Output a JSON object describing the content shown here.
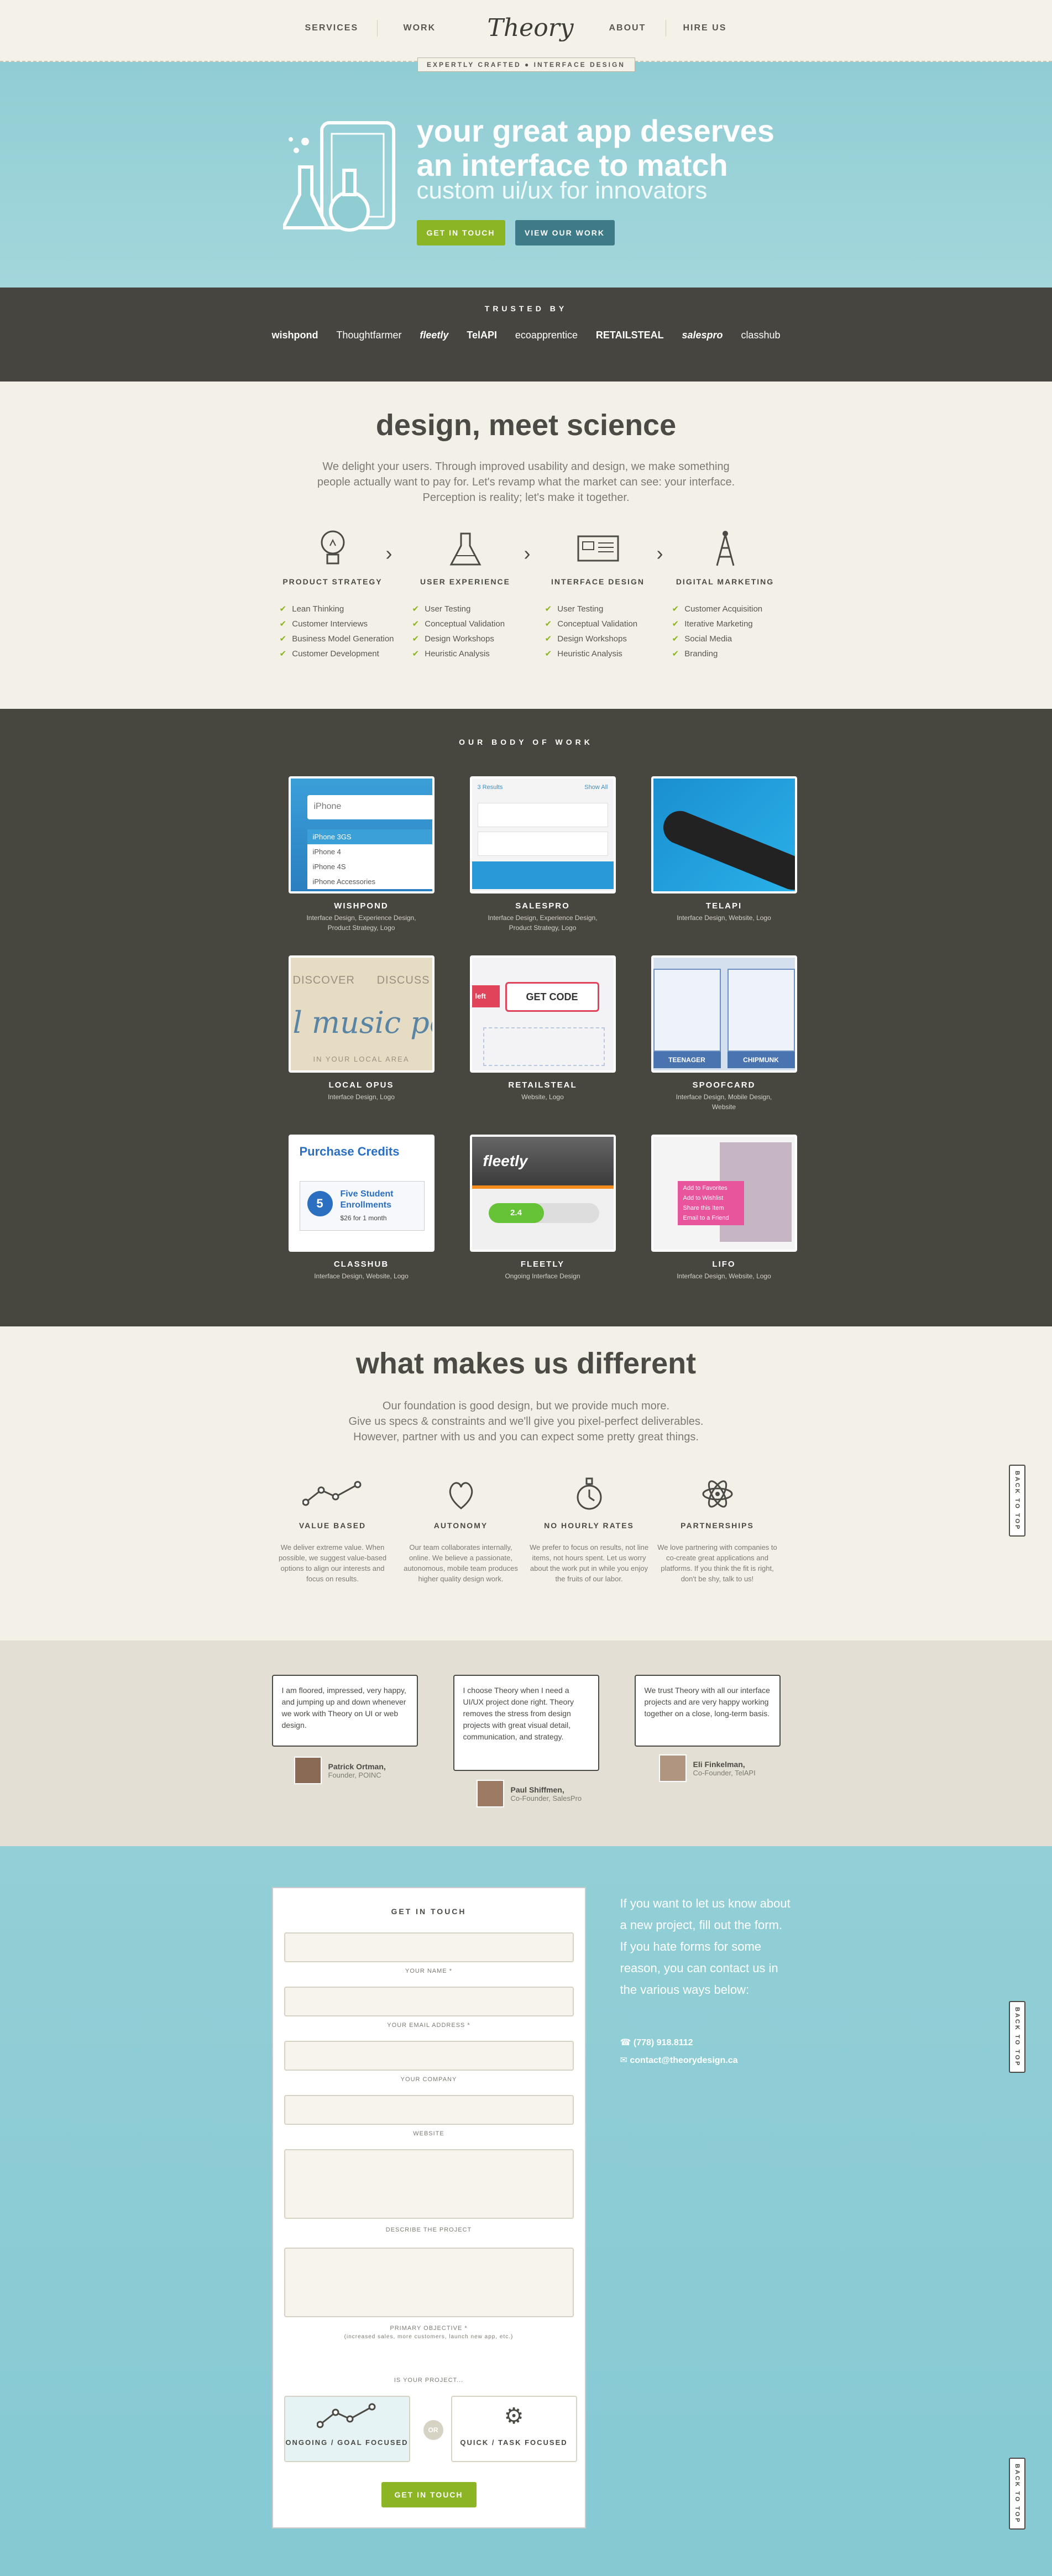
{
  "nav": {
    "services": "SERVICES",
    "work": "WORK",
    "logo": "Theory",
    "about": "ABOUT",
    "hire": "HIRE US",
    "tagline": "EXPERTLY CRAFTED ● INTERFACE DESIGN"
  },
  "hero": {
    "headline_1": "your great app deserves",
    "headline_2": "an interface to match",
    "subline": "custom ui/ux for innovators",
    "cta_primary": "GET IN TOUCH",
    "cta_secondary": "VIEW OUR WORK"
  },
  "trusted": {
    "title": "TRUSTED BY",
    "logos": [
      "wishpond",
      "Thoughtfarmer",
      "fleetly",
      "TelAPI",
      "ecoapprentice",
      "RETAILSTEAL",
      "salespro",
      "classhub"
    ]
  },
  "science": {
    "title": "design, meet science",
    "body_1": "We delight your users. Through improved usability and design, we make something",
    "body_2": "people actually want to pay for. Let's revamp what the market can see: your interface.",
    "body_3": "Perception is reality; let's make it together.",
    "services": [
      {
        "title": "PRODUCT STRATEGY",
        "items": [
          "Lean Thinking",
          "Customer Interviews",
          "Business Model Generation",
          "Customer Development"
        ]
      },
      {
        "title": "USER EXPERIENCE",
        "items": [
          "User Testing",
          "Conceptual Validation",
          "Design Workshops",
          "Heuristic Analysis"
        ]
      },
      {
        "title": "INTERFACE DESIGN",
        "items": [
          "User Testing",
          "Conceptual Validation",
          "Design Workshops",
          "Heuristic Analysis"
        ]
      },
      {
        "title": "DIGITAL MARKETING",
        "items": [
          "Customer Acquisition",
          "Iterative Marketing",
          "Social Media",
          "Branding"
        ]
      }
    ]
  },
  "work": {
    "title": "OUR BODY OF WORK",
    "projects": [
      {
        "name": "WISHPOND",
        "desc_1": "Interface Design, Experience Design,",
        "desc_2": "Product Strategy, Logo"
      },
      {
        "name": "SALESPRO",
        "desc_1": "Interface Design, Experience Design,",
        "desc_2": "Product Strategy, Logo"
      },
      {
        "name": "TELAPI",
        "desc_1": "Interface Design, Website, Logo",
        "desc_2": ""
      },
      {
        "name": "LOCAL OPUS",
        "desc_1": "Interface Design, Logo",
        "desc_2": ""
      },
      {
        "name": "RETAILSTEAL",
        "desc_1": "Website, Logo",
        "desc_2": ""
      },
      {
        "name": "SPOOFCARD",
        "desc_1": "Interface Design, Mobile Design,",
        "desc_2": "Website"
      },
      {
        "name": "CLASSHUB",
        "desc_1": "Interface Design, Website, Logo",
        "desc_2": ""
      },
      {
        "name": "FLEETLY",
        "desc_1": "Ongoing Interface Design",
        "desc_2": ""
      },
      {
        "name": "LIFO",
        "desc_1": "Interface Design, Website, Logo",
        "desc_2": ""
      }
    ],
    "thumbs": {
      "wishpond_search": "iPhone",
      "wishpond_items": [
        "iPhone 3GS",
        "iPhone 4",
        "iPhone 4S",
        "iPhone Accessories"
      ],
      "salespro_results": "3 Results",
      "salespro_show": "Show All",
      "localopus_1": "DISCOVER",
      "localopus_2": "DISCUSS",
      "localopus_3": "l music pe",
      "localopus_4": "IN YOUR LOCAL AREA",
      "retailsteal_code": "GET CODE",
      "retailsteal_left": "left",
      "spoofcard_1": "TEENAGER",
      "spoofcard_2": "CHIPMUNK",
      "classhub_title": "Purchase Credits",
      "classhub_num": "5",
      "classhub_line1": "Five Student",
      "classhub_line2": "Enrollments",
      "classhub_price": "$26 for 1 month",
      "fleetly_logo": "fleetly",
      "fleetly_value": "2.4",
      "lifo_items": [
        "Add to Favorites",
        "Add to Wishlist",
        "Share this Item",
        "Email to a Friend"
      ]
    }
  },
  "different": {
    "title": "what makes us different",
    "body_1": "Our foundation is good design, but we provide much more.",
    "body_2": "Give us specs & constraints and we'll give you pixel-perfect deliverables.",
    "body_3": "However, partner with us and you can expect some pretty great things.",
    "features": [
      {
        "title": "VALUE BASED",
        "body": "We deliver extreme value. When possible, we suggest value-based options to align our interests and focus on results."
      },
      {
        "title": "AUTONOMY",
        "body": "Our team collaborates internally, online. We believe a passionate, autonomous, mobile team produces higher quality design work."
      },
      {
        "title": "NO HOURLY RATES",
        "body": "We prefer to focus on results, not line items, not hours spent. Let us worry about the work put in while you enjoy the fruits of our labor."
      },
      {
        "title": "PARTNERSHIPS",
        "body": "We love partnering with companies to co-create great applications and platforms. If you think the fit is right, don't be shy, talk to us!"
      }
    ],
    "back_to_top": "BACK TO TOP"
  },
  "testimonials": [
    {
      "quote": "I am floored, impressed, very happy, and jumping up and down whenever we work with Theory on UI or web design.",
      "name": "Patrick Ortman,",
      "role": "Founder, POINC"
    },
    {
      "quote": "I choose Theory when I need a UI/UX project done right. Theory removes the stress from design projects with great visual detail, communication, and strategy.",
      "name": "Paul Shiffmen,",
      "role": "Co-Founder, SalesPro"
    },
    {
      "quote": "We trust Theory with all our interface projects and are very happy working together on a close, long-term basis.",
      "name": "Eli Finkelman,",
      "role": "Co-Founder, TelAPI"
    }
  ],
  "contact": {
    "form_title": "GET IN TOUCH",
    "labels": {
      "name": "YOUR NAME *",
      "email": "YOUR EMAIL ADDRESS *",
      "company": "YOUR COMPANY",
      "website": "WEBSITE",
      "describe": "DESCRIBE THE PROJECT",
      "objective": "PRIMARY OBJECTIVE *",
      "objective_hint": "(increased sales, more customers, launch new app, etc.)",
      "is_project": "IS YOUR PROJECT..."
    },
    "choice_1": "ONGOING / GOAL FOCUSED",
    "choice_or": "OR",
    "choice_2": "QUICK / TASK FOCUSED",
    "submit": "GET IN TOUCH",
    "side_text": "If you want to let us know about a new project, fill out the form. If you hate forms for some reason, you can contact us in the various ways below:",
    "phone": "(778) 918.8112",
    "email": "contact@theorydesign.ca",
    "back_to_top": "BACK TO TOP"
  },
  "colors": {
    "teal": "#90cdd3",
    "dark": "#46453f",
    "cream": "#f3f0e7",
    "green": "#8bb524"
  }
}
